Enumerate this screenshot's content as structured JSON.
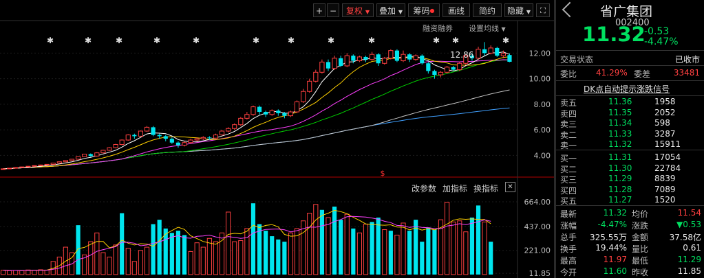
{
  "toolbar": {
    "plus": "+",
    "minus": "−",
    "fuquan": "复权",
    "diejia": "叠加",
    "chouma": "筹码",
    "huaxian": "画线",
    "jianyue": "简约",
    "yincang": "隐藏",
    "rzrq": "融资融券",
    "set_ma": "设置均线",
    "gaicanshu": "改参数",
    "jiazhibiao": "加指标",
    "huanzhibiao": "换指标",
    "close": "✕"
  },
  "price_axis": [
    "12.00",
    "10.00",
    "8.00",
    "6.00",
    "4.00"
  ],
  "volume_axis": [
    "664.00",
    "437.00",
    "221.00",
    "11.85"
  ],
  "peak_label": "12.86",
  "marker_symbol": "$",
  "colors": {
    "up": "#ff4040",
    "down": "#00e5ee",
    "ma5": "#ffffff",
    "ma10": "#ffd000",
    "ma20": "#ff40ff",
    "ma30": "#00d000",
    "ma60": "#c8c8c8",
    "ma120": "#40a0ff"
  },
  "chart_data": {
    "type": "candlestick",
    "ylim": [
      3.0,
      13.2
    ],
    "vol_ylim": [
      0,
      720
    ],
    "candles": [
      [
        2.9,
        2.95,
        2.88,
        2.97,
        "u"
      ],
      [
        2.95,
        3.0,
        2.93,
        3.02,
        "u"
      ],
      [
        3.0,
        3.05,
        2.98,
        3.07,
        "u"
      ],
      [
        3.05,
        3.1,
        3.03,
        3.12,
        "u"
      ],
      [
        3.1,
        3.15,
        3.08,
        3.17,
        "u"
      ],
      [
        3.15,
        3.2,
        3.13,
        3.22,
        "u"
      ],
      [
        3.2,
        3.25,
        3.18,
        3.28,
        "u"
      ],
      [
        3.25,
        3.3,
        3.23,
        3.32,
        "u"
      ],
      [
        3.3,
        3.4,
        3.28,
        3.42,
        "u"
      ],
      [
        3.4,
        3.5,
        3.38,
        3.52,
        "u"
      ],
      [
        3.5,
        3.6,
        3.48,
        3.62,
        "u"
      ],
      [
        3.6,
        3.7,
        3.58,
        3.72,
        "u"
      ],
      [
        3.7,
        3.9,
        3.68,
        3.92,
        "u"
      ],
      [
        3.9,
        4.1,
        3.88,
        4.12,
        "u"
      ],
      [
        4.1,
        3.95,
        3.9,
        4.15,
        "d"
      ],
      [
        3.95,
        4.2,
        3.9,
        4.25,
        "u"
      ],
      [
        4.2,
        4.4,
        4.15,
        4.45,
        "u"
      ],
      [
        4.4,
        4.6,
        4.35,
        4.65,
        "u"
      ],
      [
        4.6,
        4.85,
        4.55,
        4.9,
        "u"
      ],
      [
        4.85,
        5.2,
        4.8,
        5.25,
        "u"
      ],
      [
        5.2,
        5.6,
        5.15,
        5.65,
        "u"
      ],
      [
        5.6,
        5.5,
        5.3,
        5.7,
        "d"
      ],
      [
        5.5,
        5.9,
        5.45,
        5.95,
        "u"
      ],
      [
        5.9,
        6.2,
        5.85,
        6.3,
        "u"
      ],
      [
        6.2,
        5.6,
        5.5,
        6.3,
        "d"
      ],
      [
        5.6,
        5.5,
        5.3,
        5.7,
        "d"
      ],
      [
        5.5,
        5.3,
        5.1,
        5.6,
        "d"
      ],
      [
        5.3,
        5.0,
        4.9,
        5.4,
        "d"
      ],
      [
        5.0,
        4.8,
        4.6,
        5.1,
        "d"
      ],
      [
        4.8,
        5.0,
        4.7,
        5.1,
        "u"
      ],
      [
        5.0,
        5.2,
        4.9,
        5.3,
        "u"
      ],
      [
        5.2,
        5.3,
        5.1,
        5.4,
        "u"
      ],
      [
        5.3,
        5.4,
        5.2,
        5.5,
        "u"
      ],
      [
        5.4,
        5.35,
        5.2,
        5.5,
        "d"
      ],
      [
        5.35,
        5.6,
        5.3,
        5.7,
        "u"
      ],
      [
        5.6,
        5.9,
        5.55,
        6.0,
        "u"
      ],
      [
        5.9,
        6.1,
        5.8,
        6.2,
        "u"
      ],
      [
        6.1,
        6.4,
        6.0,
        6.5,
        "u"
      ],
      [
        6.4,
        6.9,
        6.3,
        7.0,
        "u"
      ],
      [
        6.9,
        7.2,
        6.8,
        7.4,
        "u"
      ],
      [
        7.2,
        7.8,
        7.1,
        7.9,
        "u"
      ],
      [
        7.8,
        7.4,
        7.2,
        7.9,
        "d"
      ],
      [
        7.4,
        7.2,
        7.0,
        7.5,
        "d"
      ],
      [
        7.2,
        7.5,
        7.1,
        7.6,
        "u"
      ],
      [
        7.5,
        7.3,
        7.1,
        7.6,
        "d"
      ],
      [
        7.3,
        7.1,
        6.9,
        7.4,
        "d"
      ],
      [
        7.1,
        7.4,
        7.0,
        7.5,
        "u"
      ],
      [
        7.4,
        8.2,
        7.3,
        8.3,
        "u"
      ],
      [
        8.2,
        9.0,
        8.1,
        9.2,
        "u"
      ],
      [
        9.0,
        9.8,
        8.9,
        10.0,
        "u"
      ],
      [
        9.8,
        10.5,
        9.7,
        10.7,
        "u"
      ],
      [
        10.5,
        11.3,
        10.4,
        11.5,
        "u"
      ],
      [
        11.3,
        10.8,
        10.6,
        11.5,
        "d"
      ],
      [
        10.8,
        11.6,
        10.7,
        11.8,
        "u"
      ],
      [
        11.6,
        11.0,
        10.9,
        11.8,
        "d"
      ],
      [
        11.0,
        11.8,
        10.9,
        12.0,
        "u"
      ],
      [
        11.8,
        11.4,
        11.2,
        11.9,
        "d"
      ],
      [
        11.4,
        11.7,
        11.3,
        11.8,
        "u"
      ],
      [
        11.7,
        11.5,
        11.3,
        11.8,
        "d"
      ],
      [
        11.5,
        11.9,
        11.4,
        12.1,
        "u"
      ],
      [
        11.9,
        11.2,
        11.0,
        12.0,
        "d"
      ],
      [
        11.2,
        11.6,
        11.1,
        11.7,
        "u"
      ],
      [
        11.6,
        12.2,
        11.5,
        12.3,
        "u"
      ],
      [
        12.2,
        11.4,
        11.3,
        12.3,
        "d"
      ],
      [
        11.4,
        11.9,
        11.3,
        12.2,
        "u"
      ],
      [
        11.9,
        11.5,
        11.3,
        12.0,
        "d"
      ],
      [
        11.5,
        11.8,
        11.4,
        11.9,
        "u"
      ],
      [
        11.8,
        11.2,
        11.1,
        11.9,
        "d"
      ],
      [
        11.2,
        10.6,
        10.4,
        11.3,
        "d"
      ],
      [
        10.6,
        10.3,
        10.0,
        10.7,
        "d"
      ],
      [
        10.3,
        10.5,
        10.1,
        10.6,
        "u"
      ],
      [
        10.5,
        10.9,
        10.4,
        11.0,
        "u"
      ],
      [
        10.9,
        10.7,
        10.6,
        11.0,
        "d"
      ],
      [
        10.7,
        11.2,
        10.6,
        11.3,
        "u"
      ],
      [
        11.2,
        11.8,
        11.1,
        11.9,
        "u"
      ],
      [
        11.8,
        11.6,
        11.4,
        12.0,
        "d"
      ],
      [
        11.6,
        12.3,
        11.5,
        12.5,
        "u"
      ],
      [
        12.3,
        12.0,
        11.8,
        12.86,
        "d"
      ],
      [
        12.0,
        12.4,
        11.9,
        12.6,
        "u"
      ],
      [
        12.4,
        11.8,
        11.7,
        12.5,
        "d"
      ],
      [
        11.8,
        11.97,
        11.6,
        12.2,
        "u"
      ],
      [
        11.85,
        11.32,
        11.29,
        11.97,
        "d"
      ]
    ],
    "volumes": [
      [
        40,
        "u"
      ],
      [
        35,
        "u"
      ],
      [
        38,
        "u"
      ],
      [
        36,
        "u"
      ],
      [
        42,
        "u"
      ],
      [
        39,
        "u"
      ],
      [
        44,
        "u"
      ],
      [
        41,
        "u"
      ],
      [
        120,
        "u"
      ],
      [
        160,
        "u"
      ],
      [
        250,
        "u"
      ],
      [
        200,
        "u"
      ],
      [
        450,
        "d"
      ],
      [
        180,
        "u"
      ],
      [
        300,
        "u"
      ],
      [
        380,
        "u"
      ],
      [
        200,
        "u"
      ],
      [
        160,
        "u"
      ],
      [
        270,
        "u"
      ],
      [
        560,
        "d"
      ],
      [
        240,
        "u"
      ],
      [
        120,
        "u"
      ],
      [
        220,
        "u"
      ],
      [
        250,
        "u"
      ],
      [
        460,
        "d"
      ],
      [
        500,
        "d"
      ],
      [
        420,
        "d"
      ],
      [
        380,
        "d"
      ],
      [
        400,
        "d"
      ],
      [
        360,
        "d"
      ],
      [
        210,
        "u"
      ],
      [
        290,
        "u"
      ],
      [
        250,
        "u"
      ],
      [
        330,
        "u"
      ],
      [
        300,
        "u"
      ],
      [
        380,
        "u"
      ],
      [
        570,
        "u"
      ],
      [
        300,
        "u"
      ],
      [
        310,
        "u"
      ],
      [
        420,
        "u"
      ],
      [
        650,
        "d"
      ],
      [
        460,
        "d"
      ],
      [
        400,
        "d"
      ],
      [
        350,
        "d"
      ],
      [
        320,
        "d"
      ],
      [
        300,
        "d"
      ],
      [
        380,
        "u"
      ],
      [
        420,
        "u"
      ],
      [
        490,
        "u"
      ],
      [
        560,
        "u"
      ],
      [
        640,
        "u"
      ],
      [
        590,
        "d"
      ],
      [
        520,
        "u"
      ],
      [
        620,
        "d"
      ],
      [
        500,
        "d"
      ],
      [
        550,
        "u"
      ],
      [
        420,
        "d"
      ],
      [
        380,
        "u"
      ],
      [
        460,
        "u"
      ],
      [
        480,
        "d"
      ],
      [
        520,
        "d"
      ],
      [
        410,
        "u"
      ],
      [
        400,
        "d"
      ],
      [
        360,
        "u"
      ],
      [
        470,
        "u"
      ],
      [
        400,
        "d"
      ],
      [
        500,
        "d"
      ],
      [
        300,
        "d"
      ],
      [
        430,
        "d"
      ],
      [
        410,
        "d"
      ],
      [
        500,
        "u"
      ],
      [
        660,
        "u"
      ],
      [
        480,
        "u"
      ],
      [
        490,
        "u"
      ],
      [
        390,
        "u"
      ],
      [
        520,
        "d"
      ],
      [
        630,
        "d"
      ],
      [
        480,
        "u"
      ],
      [
        300,
        "d"
      ]
    ]
  },
  "stock": {
    "name": "省广集团",
    "code": "002400",
    "price": "11.32",
    "change": "-0.53",
    "change_pct": "-4.47%"
  },
  "trade_state": {
    "label": "交易状态",
    "value": "已收市"
  },
  "weibi": {
    "label": "委比",
    "value": "41.29%",
    "label2": "委差",
    "value2": "33481"
  },
  "dk_link": "DK点自动提示涨跌信号",
  "asks": [
    {
      "label": "卖五",
      "price": "11.36",
      "vol": "1958"
    },
    {
      "label": "卖四",
      "price": "11.35",
      "vol": "2052"
    },
    {
      "label": "卖三",
      "price": "11.34",
      "vol": "598"
    },
    {
      "label": "卖二",
      "price": "11.33",
      "vol": "3287"
    },
    {
      "label": "卖一",
      "price": "11.32",
      "vol": "15911"
    }
  ],
  "bids": [
    {
      "label": "买一",
      "price": "11.31",
      "vol": "17054"
    },
    {
      "label": "买二",
      "price": "11.30",
      "vol": "22784"
    },
    {
      "label": "买三",
      "price": "11.29",
      "vol": "8839"
    },
    {
      "label": "买四",
      "price": "11.28",
      "vol": "7089"
    },
    {
      "label": "买五",
      "price": "11.27",
      "vol": "1520"
    }
  ],
  "stats": [
    {
      "l1": "最新",
      "v1": "11.32",
      "c1": "green",
      "l2": "均价",
      "v2": "11.54",
      "c2": "red"
    },
    {
      "l1": "涨幅",
      "v1": "-4.47%",
      "c1": "green",
      "l2": "涨跌",
      "v2": "▼0.53",
      "c2": "green"
    },
    {
      "l1": "总手",
      "v1": "325.55万",
      "c1": "white",
      "l2": "金额",
      "v2": "37.58亿",
      "c2": "white"
    },
    {
      "l1": "换手",
      "v1": "19.44%",
      "c1": "white",
      "l2": "量比",
      "v2": "0.61",
      "c2": "white"
    },
    {
      "l1": "最高",
      "v1": "11.97",
      "c1": "red",
      "l2": "最低",
      "v2": "11.29",
      "c2": "green"
    },
    {
      "l1": "今开",
      "v1": "11.60",
      "c1": "green",
      "l2": "昨收",
      "v2": "11.85",
      "c2": "white"
    }
  ]
}
